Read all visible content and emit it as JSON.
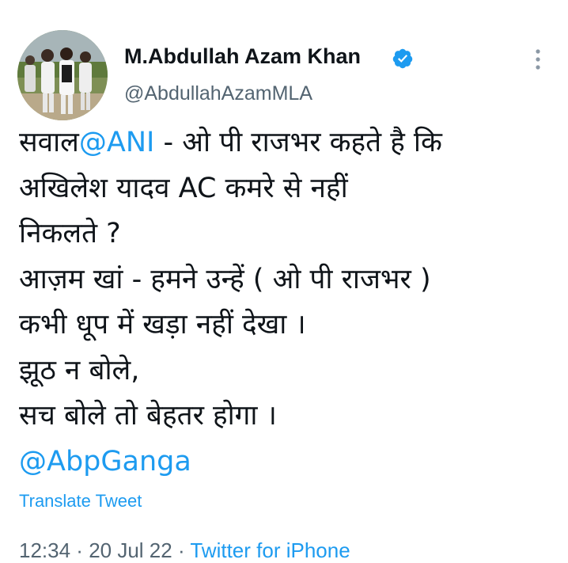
{
  "tweet": {
    "author": {
      "display_name": "M.Abdullah Azam Khan",
      "handle": "@AbdullahAzamMLA",
      "verified": true
    },
    "body": {
      "line1_prefix": "सवाल",
      "line1_mention": "@ANI",
      "line1_rest": " - ओ पी राजभर कहते है कि",
      "line2": "अखिलेश यादव AC कमरे से नहीं",
      "line3": "निकलते ?",
      "line4": "आज़म खां - हमने उन्हें ( ओ पी राजभर )",
      "line5": "कभी धूप में खड़ा नहीं देखा ।",
      "line6": "झूठ न बोले,",
      "line7": "सच बोले तो बेहतर होगा ।",
      "line8_mention": "@AbpGanga"
    },
    "translate_label": "Translate Tweet",
    "meta": {
      "time": "12:34",
      "separator1": " · ",
      "date": "20 Jul 22",
      "separator2": " · ",
      "source": "Twitter for iPhone"
    },
    "icons": {
      "verified": "verified-badge-icon",
      "more": "more-vertical-icon"
    },
    "colors": {
      "link": "#1d9bf0",
      "secondary_text": "#536471",
      "primary_text": "#0f1419"
    }
  }
}
